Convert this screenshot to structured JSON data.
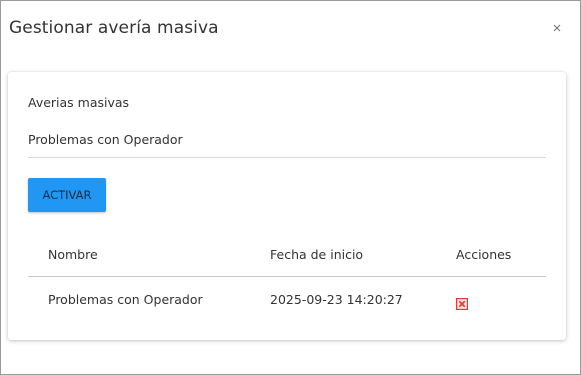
{
  "dialog": {
    "title": "Gestionar avería masiva",
    "close_icon": "close-icon"
  },
  "card": {
    "section_label": "Averias masivas",
    "select": {
      "value": "Problemas con Operador"
    },
    "activate_button": "ACTIVAR"
  },
  "table": {
    "headers": {
      "name": "Nombre",
      "start_date": "Fecha de inicio",
      "actions": "Acciones"
    },
    "rows": [
      {
        "name": "Problemas con Operador",
        "start_date": "2025-09-23 14:20:27",
        "action_icon": "delete-icon"
      }
    ]
  },
  "colors": {
    "accent": "#2196f3",
    "delete": "#e53935"
  }
}
